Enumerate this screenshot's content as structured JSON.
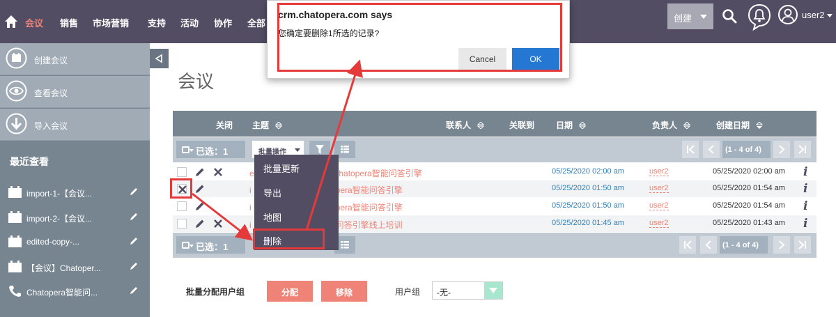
{
  "nav": {
    "items": [
      "会议",
      "销售",
      "市场营销",
      "支持",
      "活动",
      "协作",
      "全部"
    ],
    "create_label": "创建",
    "user_name": "user2"
  },
  "sidebar": {
    "actions": [
      {
        "label": "创建会议",
        "icon": "calendar-plus-icon"
      },
      {
        "label": "查看会议",
        "icon": "eye-icon"
      },
      {
        "label": "导入会议",
        "icon": "import-icon"
      }
    ],
    "recent_title": "最近查看",
    "recent_items": [
      {
        "label": "import-1-【会议...",
        "icon": "calendar-icon"
      },
      {
        "label": "import-2-【会议...",
        "icon": "calendar-icon"
      },
      {
        "label": "edited-copy-...",
        "icon": "calendar-icon"
      },
      {
        "label": "【会议】Chatoper...",
        "icon": "calendar-icon"
      },
      {
        "label": "Chatopera智能问...",
        "icon": "phone-icon"
      }
    ]
  },
  "page_title": "会议",
  "table": {
    "headers": {
      "close": "关闭",
      "subject": "主题",
      "contact": "联系人",
      "related": "关联到",
      "date": "日期",
      "assigned": "负责人",
      "created": "创建日期"
    },
    "selected_label": "已选：1",
    "bulk_action_label": "批量操作",
    "pager_text": "(1 - 4 of 4)",
    "rows": [
      {
        "subject": "e",
        "subject_tail": "Chatopera智能问答引擎",
        "date": "05/25/2020 02:00 am",
        "user": "user2",
        "created": "05/25/2020 02:00 am",
        "checked": false
      },
      {
        "subject": "i",
        "subject_tail": "pera智能问答引擎",
        "date": "05/25/2020 01:50 am",
        "user": "user2",
        "created": "05/25/2020 01:54 am",
        "checked": true
      },
      {
        "subject": "i",
        "subject_tail": "pera智能问答引擎",
        "date": "05/25/2020 01:50 am",
        "user": "user2",
        "created": "05/25/2020 01:54 am",
        "checked": false
      },
      {
        "subject": "i",
        "subject_tail": "问答引擎线上培训",
        "date": "05/25/2020 01:45 am",
        "user": "user2",
        "created": "05/25/2020 01:43 am",
        "checked": false
      }
    ]
  },
  "bulk_menu": [
    "批量更新",
    "导出",
    "地图",
    "删除"
  ],
  "mass_assign": {
    "label": "批量分配用户组",
    "assign_label": "分配",
    "remove_label": "移除",
    "group_label": "用户组",
    "group_value": "-无-"
  },
  "dialog": {
    "title": "crm.chatopera.com says",
    "message": "您确定要删除1所选的记录?",
    "cancel": "Cancel",
    "ok": "OK"
  },
  "colors": {
    "nav_bg": "#534d64",
    "accent": "#f08377",
    "sidebar_bg": "#778591",
    "ok_blue": "#2478d3",
    "highlight_red": "#e53a3a"
  }
}
